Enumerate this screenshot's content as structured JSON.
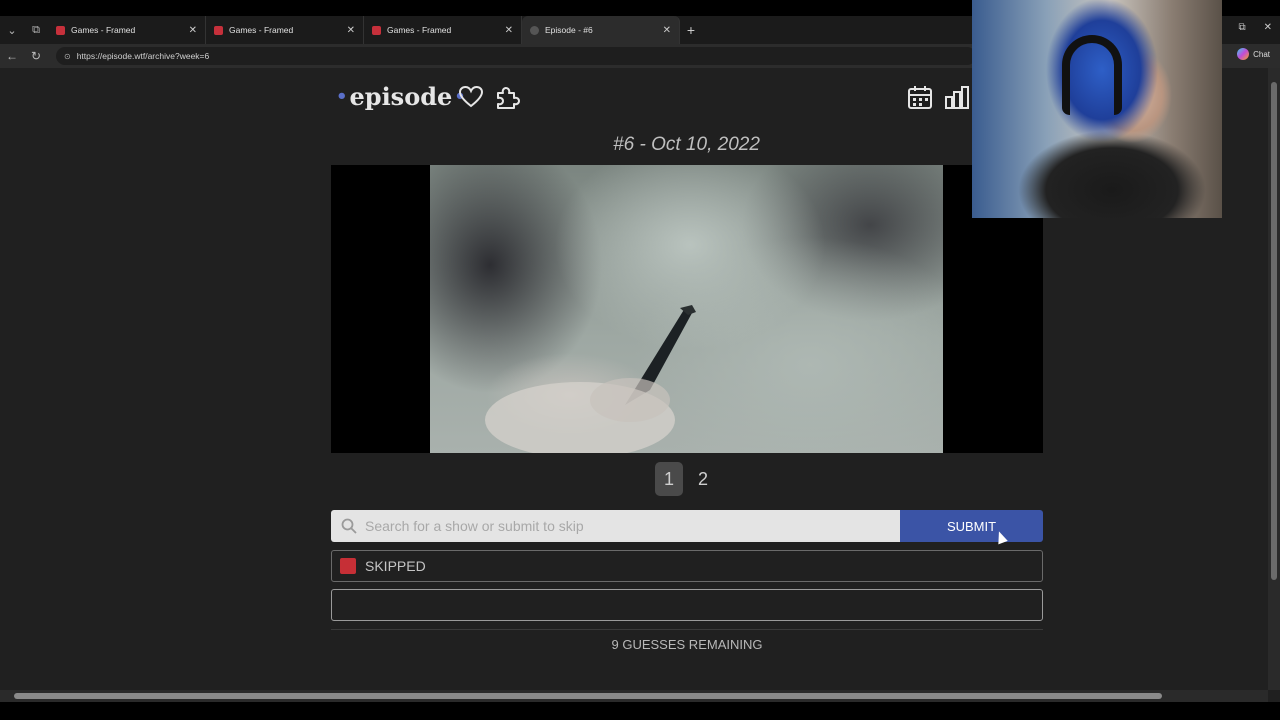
{
  "browser": {
    "tabs": [
      {
        "title": "Games - Framed",
        "icon": "framed-favicon",
        "active": false
      },
      {
        "title": "Games - Framed",
        "icon": "framed-favicon",
        "active": false
      },
      {
        "title": "Games - Framed",
        "icon": "framed-favicon",
        "active": false
      },
      {
        "title": "Episode - #6",
        "icon": "episode-favicon",
        "active": true
      }
    ],
    "new_tab": "+",
    "url": "https://episode.wtf/archive?week=6",
    "chat_label": "Chat"
  },
  "header": {
    "logo_text": "episode",
    "icons": [
      "heart-icon",
      "puzzle-icon",
      "calendar-icon",
      "bar-chart-icon"
    ]
  },
  "episode": {
    "title": "#6 - Oct 10, 2022"
  },
  "pager": {
    "pages": [
      "1",
      "2"
    ],
    "active_page": 1
  },
  "search": {
    "placeholder": "Search for a show or submit to skip",
    "value": "",
    "submit_label": "SUBMIT"
  },
  "guesses": [
    {
      "label": "SKIPPED",
      "status": "skipped",
      "color": "#c62f36"
    },
    {
      "label": "",
      "status": "pending"
    }
  ],
  "remaining_text": "9 GUESSES REMAINING",
  "colors": {
    "accent": "#3b54a6",
    "logo_dot": "#5a6fc9",
    "background": "#202020"
  }
}
